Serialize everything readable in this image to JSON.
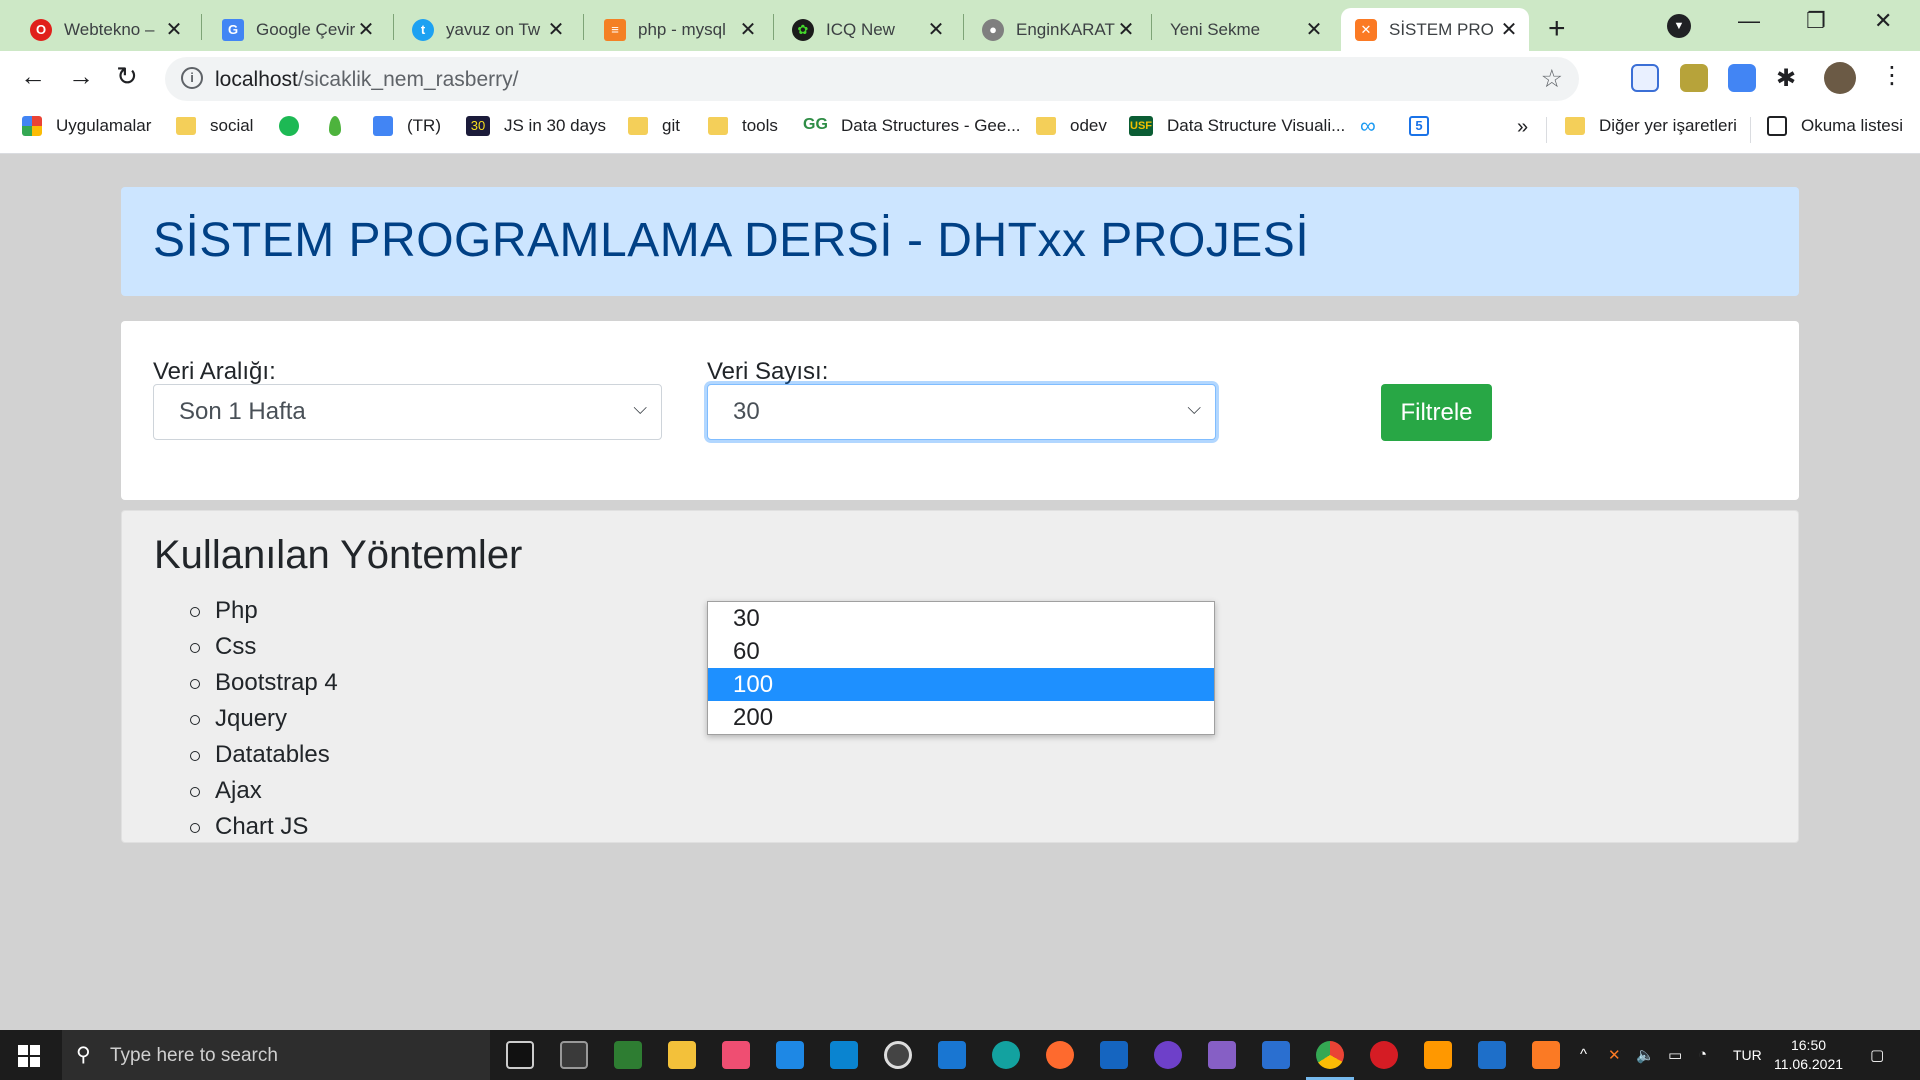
{
  "browser": {
    "tabs": [
      {
        "title": "Webtekno –",
        "icon": "opera-icon",
        "color": "#e0201b"
      },
      {
        "title": "Google Çevir",
        "icon": "google-translate-icon",
        "color": "#4285f4"
      },
      {
        "title": "yavuz on Tw",
        "icon": "twitter-icon",
        "color": "#1da1f2"
      },
      {
        "title": "php - mysql",
        "icon": "stackoverflow-icon",
        "color": "#f48024"
      },
      {
        "title": "ICQ New",
        "icon": "icq-icon",
        "color": "#1b1b1b"
      },
      {
        "title": "EnginKARAT",
        "icon": "github-icon",
        "color": "#7f7f7f"
      },
      {
        "title": "Yeni Sekme",
        "icon": "",
        "color": ""
      },
      {
        "title": "SİSTEM PRO",
        "icon": "xampp-icon",
        "color": "#fb7a24"
      }
    ],
    "url_host": "localhost",
    "url_path": "/sicaklik_nem_rasberry/",
    "bookmarks": [
      {
        "label": "Uygulamalar",
        "icon": "apps-grid-icon"
      },
      {
        "label": "social",
        "icon": "folder-icon"
      },
      {
        "label": "",
        "icon": "spotify-icon"
      },
      {
        "label": "",
        "icon": "mongodb-leaf-icon"
      },
      {
        "label": "(TR)",
        "icon": "google-translate-icon"
      },
      {
        "label": "JS in 30 days",
        "icon": "js30-icon"
      },
      {
        "label": "git",
        "icon": "folder-icon"
      },
      {
        "label": "tools",
        "icon": "folder-icon"
      },
      {
        "label": "Data Structures - Gee...",
        "icon": "geeksforgeeks-icon"
      },
      {
        "label": "odev",
        "icon": "folder-icon"
      },
      {
        "label": "Data Structure Visuali...",
        "icon": "usf-icon"
      },
      {
        "label": "",
        "icon": "infinity-icon"
      },
      {
        "label": "",
        "icon": "calendar-5-icon"
      }
    ],
    "overflow_label": "»",
    "other_bookmarks": "Diğer yer işaretleri",
    "reading_list": "Okuma listesi"
  },
  "page": {
    "title": "SİSTEM PROGRAMLAMA DERSİ - DHTxx PROJESİ",
    "range_label": "Veri Aralığı:",
    "range_value": "Son 1 Hafta",
    "count_label": "Veri Sayısı:",
    "count_value": "30",
    "filter_button": "Filtrele",
    "count_options": [
      "30",
      "60",
      "100",
      "200"
    ],
    "highlighted_option": "100",
    "methods_title": "Kullanılan Yöntemler",
    "methods": [
      "Php",
      "Css",
      "Bootstrap 4",
      "Jquery",
      "Datatables",
      "Ajax",
      "Chart JS"
    ]
  },
  "taskbar": {
    "search_placeholder": "Type here to search",
    "language": "TUR",
    "time": "16:50",
    "date": "11.06.2021"
  }
}
